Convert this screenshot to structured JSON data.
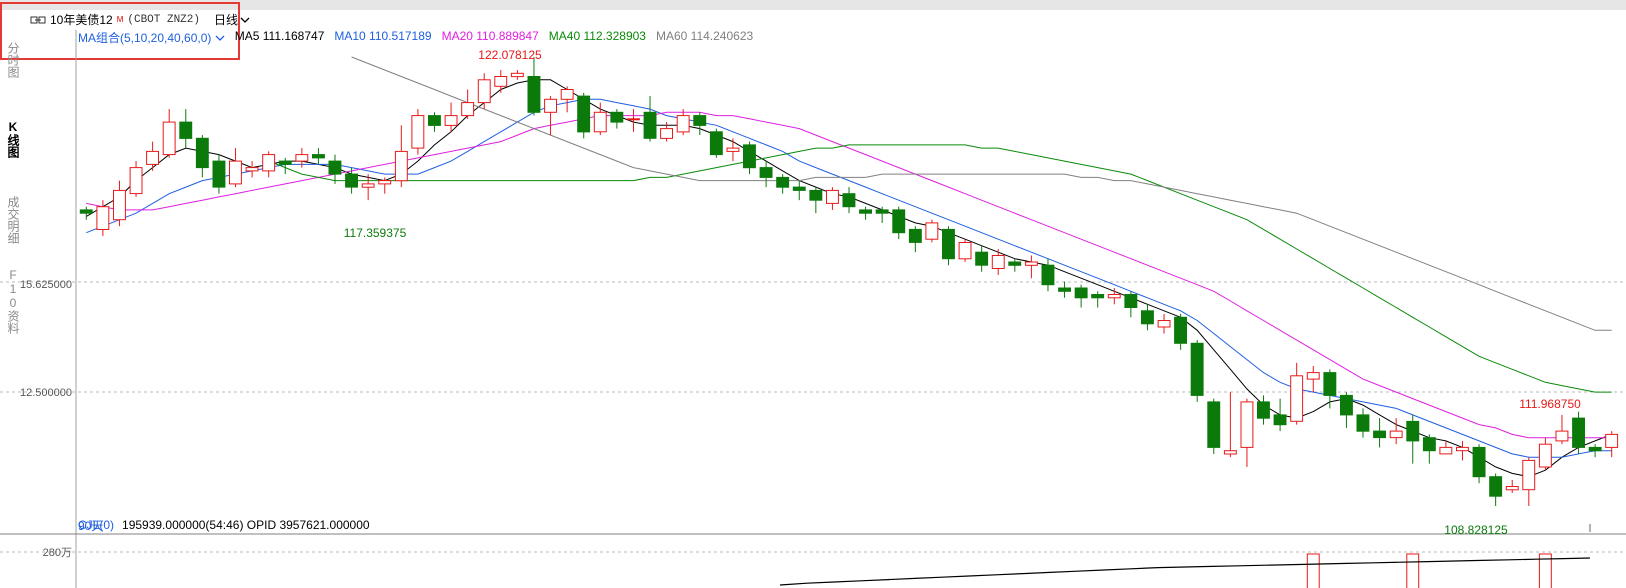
{
  "header": {
    "symbol_name": "10年美债12",
    "symbol_flag": "M",
    "symbol_code": "(CBOT ZNZ2)",
    "period_label": "日线"
  },
  "side_tabs": [
    "分时图",
    "K线图",
    "成交明细",
    "F10资料"
  ],
  "ma_legend": {
    "group_label": "MA组合(5,10,20,40,60,0)",
    "items": [
      {
        "label": "MA5 111.168747",
        "color": "#000000"
      },
      {
        "label": "MA10 110.517189",
        "color": "#1f5fe0"
      },
      {
        "label": "MA20 110.889847",
        "color": "#e020e0"
      },
      {
        "label": "MA40 112.328903",
        "color": "#0a8a0a"
      },
      {
        "label": "MA60 114.240623",
        "color": "#808080"
      }
    ]
  },
  "colors": {
    "up": "#e8191a",
    "down": "#0b7a0b",
    "grid": "#b9b9b9",
    "axis": "#a0a0a0",
    "legend_blue": "#1f5fe0"
  },
  "annotations": {
    "high": "122.078125",
    "low_left": "117.359375",
    "recent_high": "111.968750",
    "low": "108.828125",
    "days": "90天"
  },
  "volume_panel": {
    "legend": "CJL(0)",
    "stats": "195939.000000(54:46)  OPID 3957621.000000",
    "axis_label": "280万"
  },
  "chart_data": {
    "type": "candlestick",
    "y_ticks": [
      "15.625000",
      "12.500000"
    ],
    "ylim": [
      108.0,
      123.0
    ],
    "candles": [
      [
        117.9,
        117.8,
        118.0,
        117.6
      ],
      [
        117.3,
        118.0,
        118.2,
        117.1
      ],
      [
        117.6,
        118.5,
        118.8,
        117.4
      ],
      [
        118.4,
        119.2,
        119.4,
        118.3
      ],
      [
        119.3,
        119.7,
        120.0,
        119.1
      ],
      [
        119.6,
        120.6,
        121.0,
        119.5
      ],
      [
        120.6,
        120.1,
        121.0,
        119.8
      ],
      [
        120.1,
        119.2,
        120.2,
        118.9
      ],
      [
        119.4,
        118.6,
        119.6,
        118.4
      ],
      [
        118.7,
        119.4,
        119.8,
        118.6
      ],
      [
        119.1,
        119.2,
        119.4,
        118.9
      ],
      [
        119.1,
        119.6,
        119.7,
        118.9
      ],
      [
        119.4,
        119.3,
        119.5,
        119.0
      ],
      [
        119.4,
        119.6,
        119.8,
        119.2
      ],
      [
        119.6,
        119.5,
        119.8,
        119.3
      ],
      [
        119.4,
        119.0,
        119.6,
        118.7
      ],
      [
        119.0,
        118.6,
        119.2,
        118.4
      ],
      [
        118.6,
        118.7,
        119.0,
        118.2
      ],
      [
        118.7,
        118.8,
        118.9,
        118.4
      ],
      [
        118.8,
        119.7,
        120.5,
        118.6
      ],
      [
        119.8,
        120.8,
        121.0,
        119.6
      ],
      [
        120.8,
        120.5,
        120.9,
        120.3
      ],
      [
        120.5,
        120.8,
        121.2,
        120.3
      ],
      [
        120.8,
        121.2,
        121.6,
        120.7
      ],
      [
        121.2,
        121.9,
        122.1,
        121.0
      ],
      [
        121.7,
        122.0,
        122.2,
        121.5
      ],
      [
        122.0,
        122.1,
        122.2,
        121.9
      ],
      [
        122.0,
        120.9,
        122.6,
        120.8
      ],
      [
        120.9,
        121.3,
        121.4,
        120.2
      ],
      [
        121.3,
        121.6,
        121.7,
        120.9
      ],
      [
        121.4,
        120.3,
        121.5,
        120.1
      ],
      [
        120.3,
        120.9,
        121.2,
        120.2
      ],
      [
        120.9,
        120.6,
        121.0,
        120.4
      ],
      [
        120.7,
        120.7,
        121.0,
        120.3
      ],
      [
        120.9,
        120.1,
        121.4,
        120.0
      ],
      [
        120.1,
        120.4,
        120.6,
        120.0
      ],
      [
        120.3,
        120.8,
        121.0,
        120.2
      ],
      [
        120.8,
        120.5,
        120.9,
        120.2
      ],
      [
        120.3,
        119.6,
        120.4,
        119.5
      ],
      [
        119.7,
        119.8,
        120.1,
        119.4
      ],
      [
        119.9,
        119.2,
        120.0,
        119.0
      ],
      [
        119.2,
        118.9,
        119.4,
        118.6
      ],
      [
        118.9,
        118.6,
        119.0,
        118.4
      ],
      [
        118.6,
        118.5,
        118.8,
        118.2
      ],
      [
        118.5,
        118.2,
        118.6,
        117.8
      ],
      [
        118.1,
        118.5,
        118.6,
        117.9
      ],
      [
        118.4,
        118.0,
        118.6,
        117.8
      ],
      [
        117.9,
        117.8,
        118.0,
        117.6
      ],
      [
        117.9,
        117.8,
        118.0,
        117.5
      ],
      [
        117.9,
        117.2,
        118.0,
        117.0
      ],
      [
        117.3,
        116.9,
        117.4,
        116.6
      ],
      [
        117.0,
        117.5,
        117.6,
        116.9
      ],
      [
        117.3,
        116.4,
        117.4,
        116.2
      ],
      [
        116.4,
        116.9,
        117.0,
        116.3
      ],
      [
        116.6,
        116.2,
        116.8,
        116.0
      ],
      [
        116.1,
        116.5,
        116.7,
        115.9
      ],
      [
        116.3,
        116.2,
        116.4,
        116.0
      ],
      [
        116.2,
        116.3,
        116.5,
        115.8
      ],
      [
        116.2,
        115.6,
        116.4,
        115.4
      ],
      [
        115.5,
        115.4,
        115.7,
        115.2
      ],
      [
        115.5,
        115.2,
        115.6,
        114.9
      ],
      [
        115.3,
        115.2,
        115.4,
        114.9
      ],
      [
        115.2,
        115.3,
        115.5,
        115.0
      ],
      [
        115.3,
        114.9,
        115.4,
        114.6
      ],
      [
        114.8,
        114.4,
        115.0,
        114.2
      ],
      [
        114.3,
        114.5,
        114.7,
        114.1
      ],
      [
        114.6,
        113.8,
        114.7,
        113.6
      ],
      [
        113.8,
        112.2,
        113.9,
        112.0
      ],
      [
        112.0,
        110.6,
        112.1,
        110.4
      ],
      [
        110.4,
        110.5,
        112.3,
        110.3
      ],
      [
        110.6,
        112.0,
        112.1,
        110.0
      ],
      [
        112.0,
        111.5,
        112.2,
        111.3
      ],
      [
        111.6,
        111.3,
        112.1,
        111.1
      ],
      [
        111.4,
        112.8,
        113.2,
        111.3
      ],
      [
        112.7,
        112.9,
        113.1,
        112.3
      ],
      [
        112.9,
        112.2,
        113.0,
        111.8
      ],
      [
        112.2,
        111.6,
        112.3,
        111.2
      ],
      [
        111.6,
        111.1,
        111.8,
        110.9
      ],
      [
        111.1,
        110.9,
        111.5,
        110.6
      ],
      [
        110.9,
        111.1,
        111.5,
        110.7
      ],
      [
        111.4,
        110.8,
        111.6,
        110.1
      ],
      [
        110.9,
        110.5,
        111.0,
        110.1
      ],
      [
        110.4,
        110.6,
        110.8,
        110.4
      ],
      [
        110.5,
        110.6,
        110.8,
        110.2
      ],
      [
        110.6,
        109.7,
        110.7,
        109.5
      ],
      [
        109.7,
        109.1,
        109.8,
        108.8
      ],
      [
        109.3,
        109.4,
        109.6,
        109.2
      ],
      [
        109.3,
        110.2,
        110.3,
        108.8
      ],
      [
        110.0,
        110.7,
        110.9,
        109.9
      ],
      [
        110.8,
        111.1,
        111.6,
        110.7
      ],
      [
        111.5,
        110.6,
        111.7,
        110.4
      ],
      [
        110.6,
        110.5,
        110.7,
        110.3
      ],
      [
        110.6,
        111.0,
        111.1,
        110.3
      ]
    ],
    "ma_series": [
      {
        "name": "MA5",
        "color": "#000000",
        "values": [
          117.7,
          118.0,
          118.3,
          118.8,
          119.2,
          119.6,
          119.8,
          119.7,
          119.6,
          119.4,
          119.2,
          119.3,
          119.4,
          119.4,
          119.3,
          119.2,
          119.0,
          118.9,
          118.8,
          119.0,
          119.4,
          119.9,
          120.3,
          120.8,
          121.2,
          121.6,
          121.8,
          121.9,
          121.9,
          121.6,
          121.3,
          121.0,
          120.8,
          120.6,
          120.5,
          120.5,
          120.5,
          120.4,
          120.2,
          120.0,
          119.7,
          119.4,
          119.1,
          118.8,
          118.6,
          118.4,
          118.3,
          118.1,
          117.9,
          117.7,
          117.5,
          117.4,
          117.2,
          117.0,
          116.8,
          116.6,
          116.4,
          116.3,
          116.2,
          116.0,
          115.8,
          115.6,
          115.4,
          115.2,
          115.0,
          114.8,
          114.6,
          114.2,
          113.6,
          113.0,
          112.4,
          111.9,
          111.6,
          111.5,
          111.7,
          112.0,
          112.1,
          111.9,
          111.6,
          111.3,
          111.1,
          110.9,
          110.8,
          110.6,
          110.3,
          110.0,
          109.8,
          109.7,
          109.9,
          110.3,
          110.6,
          110.8,
          111.0
        ]
      },
      {
        "name": "MA10",
        "color": "#1f5fe0",
        "values": [
          117.2,
          117.4,
          117.6,
          117.8,
          118.1,
          118.4,
          118.6,
          118.8,
          118.9,
          119.0,
          119.1,
          119.2,
          119.3,
          119.3,
          119.3,
          119.3,
          119.2,
          119.1,
          119.0,
          119.0,
          119.0,
          119.2,
          119.4,
          119.7,
          120.0,
          120.3,
          120.6,
          120.9,
          121.1,
          121.2,
          121.3,
          121.3,
          121.2,
          121.1,
          121.0,
          120.8,
          120.7,
          120.6,
          120.5,
          120.3,
          120.1,
          119.9,
          119.7,
          119.4,
          119.2,
          119.0,
          118.8,
          118.6,
          118.4,
          118.2,
          118.0,
          117.8,
          117.6,
          117.4,
          117.2,
          117.0,
          116.8,
          116.6,
          116.4,
          116.2,
          116.0,
          115.8,
          115.6,
          115.4,
          115.2,
          115.0,
          114.8,
          114.5,
          114.1,
          113.7,
          113.3,
          112.9,
          112.6,
          112.4,
          112.3,
          112.2,
          112.1,
          112.0,
          111.9,
          111.8,
          111.6,
          111.4,
          111.2,
          111.0,
          110.8,
          110.6,
          110.4,
          110.3,
          110.3,
          110.3,
          110.4,
          110.5,
          110.5
        ]
      },
      {
        "name": "MA20",
        "color": "#e020e0",
        "values": [
          118.1,
          118.0,
          117.9,
          117.9,
          117.9,
          118.0,
          118.1,
          118.2,
          118.3,
          118.4,
          118.5,
          118.6,
          118.7,
          118.8,
          118.9,
          119.0,
          119.1,
          119.2,
          119.3,
          119.4,
          119.5,
          119.6,
          119.7,
          119.8,
          119.9,
          120.0,
          120.2,
          120.4,
          120.5,
          120.6,
          120.7,
          120.8,
          120.8,
          120.8,
          120.8,
          120.9,
          120.9,
          120.9,
          120.8,
          120.8,
          120.7,
          120.6,
          120.5,
          120.4,
          120.2,
          120.0,
          119.8,
          119.6,
          119.4,
          119.2,
          119.0,
          118.8,
          118.6,
          118.4,
          118.2,
          118.0,
          117.8,
          117.6,
          117.4,
          117.2,
          117.0,
          116.8,
          116.6,
          116.4,
          116.2,
          116.0,
          115.8,
          115.6,
          115.4,
          115.1,
          114.8,
          114.5,
          114.2,
          113.9,
          113.6,
          113.3,
          113.0,
          112.7,
          112.5,
          112.3,
          112.1,
          111.9,
          111.7,
          111.5,
          111.3,
          111.2,
          111.0,
          110.9,
          110.9,
          110.9,
          110.9,
          110.9,
          110.9
        ]
      },
      {
        "name": "MA40",
        "color": "#0a8a0a",
        "values": [
          119.4,
          119.2,
          119.0,
          118.9,
          118.8,
          118.8,
          118.8,
          118.8,
          118.8,
          118.8,
          118.8,
          118.8,
          118.8,
          118.8,
          118.8,
          118.8,
          118.8,
          118.8,
          118.8,
          118.8,
          118.8,
          118.8,
          118.8,
          118.9,
          118.9,
          119.0,
          119.1,
          119.2,
          119.3,
          119.4,
          119.5,
          119.6,
          119.7,
          119.8,
          119.8,
          119.9,
          119.9,
          119.9,
          119.9,
          119.9,
          119.9,
          119.9,
          119.9,
          119.8,
          119.8,
          119.7,
          119.6,
          119.5,
          119.4,
          119.3,
          119.2,
          119.1,
          119.0,
          118.8,
          118.6,
          118.4,
          118.2,
          118.0,
          117.8,
          117.6,
          117.3,
          117.0,
          116.7,
          116.4,
          116.1,
          115.8,
          115.5,
          115.2,
          114.9,
          114.6,
          114.3,
          114.0,
          113.7,
          113.4,
          113.2,
          113.0,
          112.8,
          112.6,
          112.5,
          112.4,
          112.3,
          112.3
        ]
      },
      {
        "name": "MA60",
        "color": "#808080",
        "values": [
          122.6,
          122.4,
          122.2,
          122.0,
          121.8,
          121.6,
          121.4,
          121.2,
          121.0,
          120.8,
          120.6,
          120.4,
          120.2,
          120.0,
          119.8,
          119.6,
          119.4,
          119.2,
          119.1,
          119.0,
          118.9,
          118.8,
          118.8,
          118.8,
          118.8,
          118.8,
          118.8,
          118.8,
          118.9,
          118.9,
          118.9,
          118.9,
          119.0,
          119.0,
          119.0,
          119.0,
          119.0,
          119.0,
          119.0,
          119.0,
          119.0,
          119.0,
          119.0,
          119.0,
          118.9,
          118.9,
          118.8,
          118.8,
          118.7,
          118.6,
          118.5,
          118.4,
          118.3,
          118.2,
          118.1,
          118.0,
          117.9,
          117.8,
          117.6,
          117.4,
          117.2,
          117.0,
          116.8,
          116.6,
          116.4,
          116.2,
          116.0,
          115.8,
          115.6,
          115.4,
          115.2,
          115.0,
          114.8,
          114.6,
          114.4,
          114.2,
          114.2
        ]
      }
    ],
    "volumes": [
      0,
      0,
      0,
      0,
      0,
      0,
      0,
      0,
      0,
      0,
      0,
      0,
      0,
      0,
      0,
      0,
      0,
      0,
      0,
      0,
      0,
      0,
      0,
      0,
      0,
      0,
      0,
      0,
      0,
      0,
      0,
      0,
      0,
      0,
      0,
      0,
      0,
      0,
      0,
      0,
      0,
      0,
      0,
      0,
      0,
      0,
      0,
      0,
      0,
      0,
      0,
      0,
      0,
      0,
      0,
      0,
      0,
      0,
      0,
      0,
      0,
      0,
      0,
      0,
      0,
      0,
      0,
      0,
      0,
      0,
      0,
      0,
      0,
      0,
      1,
      0,
      0,
      0,
      0,
      0,
      1,
      0,
      0,
      0,
      0,
      0,
      0,
      0,
      1,
      0,
      0,
      0,
      0
    ],
    "volume_average": [
      0.05,
      0.08,
      0.1,
      0.12,
      0.14,
      0.16,
      0.18,
      0.2,
      0.22,
      0.24,
      0.26,
      0.28,
      0.3,
      0.32,
      0.34,
      0.35,
      0.36,
      0.37,
      0.38,
      0.39,
      0.4,
      0.41,
      0.42,
      0.43,
      0.44,
      0.45,
      0.46,
      0.47,
      0.48,
      0.49,
      0.5
    ]
  }
}
